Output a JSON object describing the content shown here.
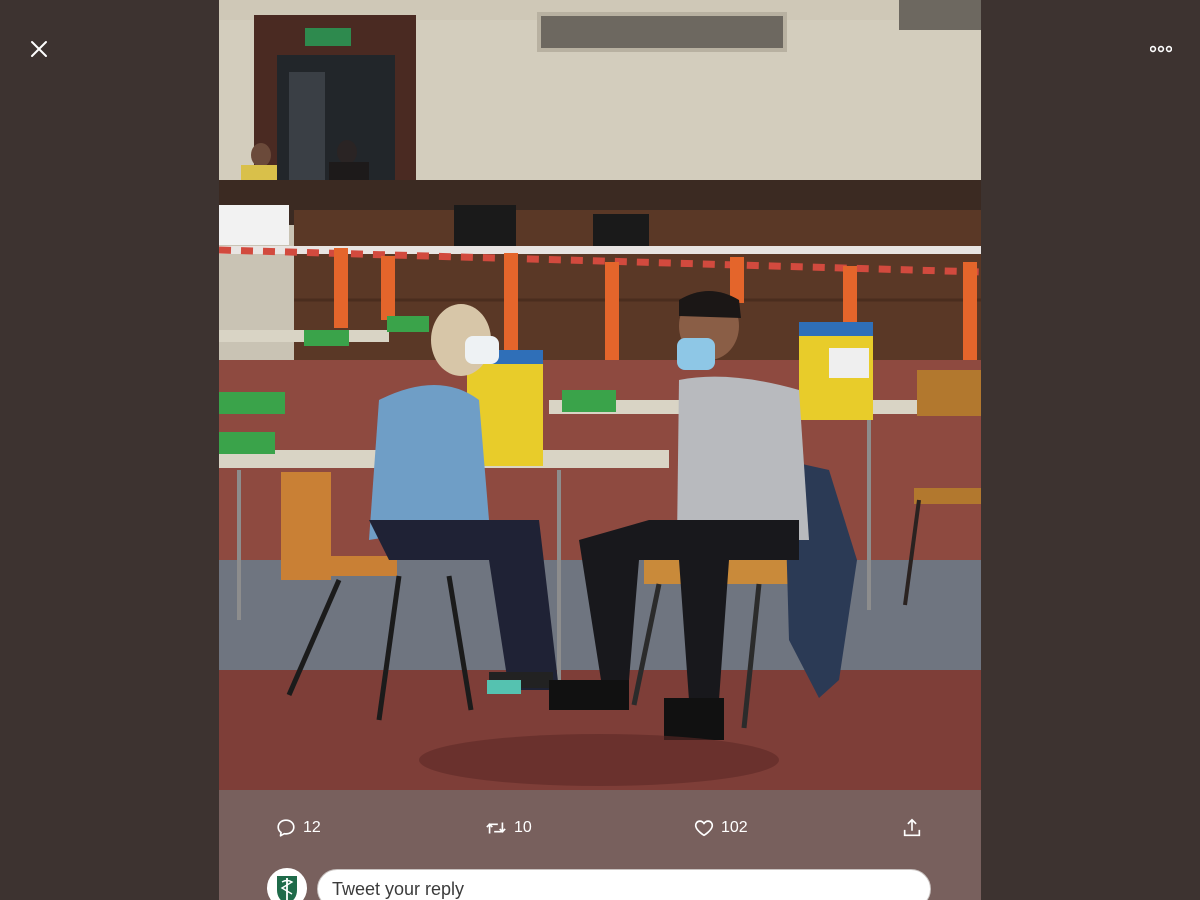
{
  "viewer": {
    "close_icon": "close-icon",
    "more_icon": "more-horizontal-icon",
    "background_color": "#3d3330"
  },
  "photo": {
    "alt": "Vaccination hall: a nurse in blue scrubs and a mask sits facing a seated man in a grey t-shirt and mask",
    "sign_text": ""
  },
  "actions": {
    "reply": {
      "icon": "reply-icon",
      "count": "12"
    },
    "retweet": {
      "icon": "retweet-icon",
      "count": "10"
    },
    "like": {
      "icon": "heart-icon",
      "count": "102"
    },
    "share": {
      "icon": "share-icon"
    }
  },
  "reply_composer": {
    "placeholder": "Tweet your reply",
    "avatar_icon": "caduceus-avatar-icon"
  }
}
